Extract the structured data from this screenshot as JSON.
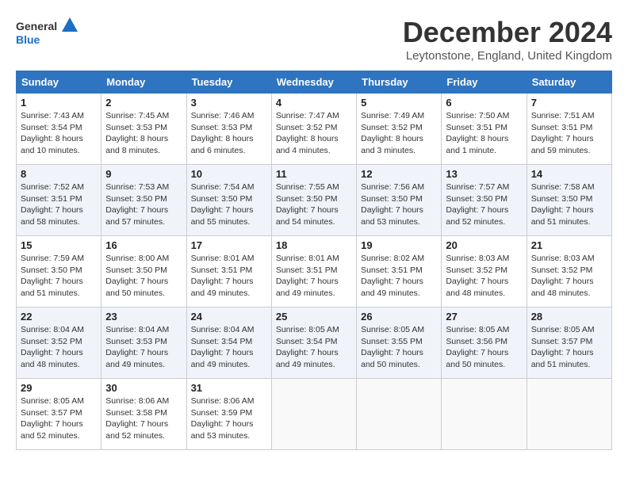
{
  "logo": {
    "line1": "General",
    "line2": "Blue"
  },
  "title": "December 2024",
  "location": "Leytonstone, England, United Kingdom",
  "weekdays": [
    "Sunday",
    "Monday",
    "Tuesday",
    "Wednesday",
    "Thursday",
    "Friday",
    "Saturday"
  ],
  "weeks": [
    [
      {
        "day": "1",
        "lines": [
          "Sunrise: 7:43 AM",
          "Sunset: 3:54 PM",
          "Daylight: 8 hours",
          "and 10 minutes."
        ]
      },
      {
        "day": "2",
        "lines": [
          "Sunrise: 7:45 AM",
          "Sunset: 3:53 PM",
          "Daylight: 8 hours",
          "and 8 minutes."
        ]
      },
      {
        "day": "3",
        "lines": [
          "Sunrise: 7:46 AM",
          "Sunset: 3:53 PM",
          "Daylight: 8 hours",
          "and 6 minutes."
        ]
      },
      {
        "day": "4",
        "lines": [
          "Sunrise: 7:47 AM",
          "Sunset: 3:52 PM",
          "Daylight: 8 hours",
          "and 4 minutes."
        ]
      },
      {
        "day": "5",
        "lines": [
          "Sunrise: 7:49 AM",
          "Sunset: 3:52 PM",
          "Daylight: 8 hours",
          "and 3 minutes."
        ]
      },
      {
        "day": "6",
        "lines": [
          "Sunrise: 7:50 AM",
          "Sunset: 3:51 PM",
          "Daylight: 8 hours",
          "and 1 minute."
        ]
      },
      {
        "day": "7",
        "lines": [
          "Sunrise: 7:51 AM",
          "Sunset: 3:51 PM",
          "Daylight: 7 hours",
          "and 59 minutes."
        ]
      }
    ],
    [
      {
        "day": "8",
        "lines": [
          "Sunrise: 7:52 AM",
          "Sunset: 3:51 PM",
          "Daylight: 7 hours",
          "and 58 minutes."
        ]
      },
      {
        "day": "9",
        "lines": [
          "Sunrise: 7:53 AM",
          "Sunset: 3:50 PM",
          "Daylight: 7 hours",
          "and 57 minutes."
        ]
      },
      {
        "day": "10",
        "lines": [
          "Sunrise: 7:54 AM",
          "Sunset: 3:50 PM",
          "Daylight: 7 hours",
          "and 55 minutes."
        ]
      },
      {
        "day": "11",
        "lines": [
          "Sunrise: 7:55 AM",
          "Sunset: 3:50 PM",
          "Daylight: 7 hours",
          "and 54 minutes."
        ]
      },
      {
        "day": "12",
        "lines": [
          "Sunrise: 7:56 AM",
          "Sunset: 3:50 PM",
          "Daylight: 7 hours",
          "and 53 minutes."
        ]
      },
      {
        "day": "13",
        "lines": [
          "Sunrise: 7:57 AM",
          "Sunset: 3:50 PM",
          "Daylight: 7 hours",
          "and 52 minutes."
        ]
      },
      {
        "day": "14",
        "lines": [
          "Sunrise: 7:58 AM",
          "Sunset: 3:50 PM",
          "Daylight: 7 hours",
          "and 51 minutes."
        ]
      }
    ],
    [
      {
        "day": "15",
        "lines": [
          "Sunrise: 7:59 AM",
          "Sunset: 3:50 PM",
          "Daylight: 7 hours",
          "and 51 minutes."
        ]
      },
      {
        "day": "16",
        "lines": [
          "Sunrise: 8:00 AM",
          "Sunset: 3:50 PM",
          "Daylight: 7 hours",
          "and 50 minutes."
        ]
      },
      {
        "day": "17",
        "lines": [
          "Sunrise: 8:01 AM",
          "Sunset: 3:51 PM",
          "Daylight: 7 hours",
          "and 49 minutes."
        ]
      },
      {
        "day": "18",
        "lines": [
          "Sunrise: 8:01 AM",
          "Sunset: 3:51 PM",
          "Daylight: 7 hours",
          "and 49 minutes."
        ]
      },
      {
        "day": "19",
        "lines": [
          "Sunrise: 8:02 AM",
          "Sunset: 3:51 PM",
          "Daylight: 7 hours",
          "and 49 minutes."
        ]
      },
      {
        "day": "20",
        "lines": [
          "Sunrise: 8:03 AM",
          "Sunset: 3:52 PM",
          "Daylight: 7 hours",
          "and 48 minutes."
        ]
      },
      {
        "day": "21",
        "lines": [
          "Sunrise: 8:03 AM",
          "Sunset: 3:52 PM",
          "Daylight: 7 hours",
          "and 48 minutes."
        ]
      }
    ],
    [
      {
        "day": "22",
        "lines": [
          "Sunrise: 8:04 AM",
          "Sunset: 3:52 PM",
          "Daylight: 7 hours",
          "and 48 minutes."
        ]
      },
      {
        "day": "23",
        "lines": [
          "Sunrise: 8:04 AM",
          "Sunset: 3:53 PM",
          "Daylight: 7 hours",
          "and 49 minutes."
        ]
      },
      {
        "day": "24",
        "lines": [
          "Sunrise: 8:04 AM",
          "Sunset: 3:54 PM",
          "Daylight: 7 hours",
          "and 49 minutes."
        ]
      },
      {
        "day": "25",
        "lines": [
          "Sunrise: 8:05 AM",
          "Sunset: 3:54 PM",
          "Daylight: 7 hours",
          "and 49 minutes."
        ]
      },
      {
        "day": "26",
        "lines": [
          "Sunrise: 8:05 AM",
          "Sunset: 3:55 PM",
          "Daylight: 7 hours",
          "and 50 minutes."
        ]
      },
      {
        "day": "27",
        "lines": [
          "Sunrise: 8:05 AM",
          "Sunset: 3:56 PM",
          "Daylight: 7 hours",
          "and 50 minutes."
        ]
      },
      {
        "day": "28",
        "lines": [
          "Sunrise: 8:05 AM",
          "Sunset: 3:57 PM",
          "Daylight: 7 hours",
          "and 51 minutes."
        ]
      }
    ],
    [
      {
        "day": "29",
        "lines": [
          "Sunrise: 8:05 AM",
          "Sunset: 3:57 PM",
          "Daylight: 7 hours",
          "and 52 minutes."
        ]
      },
      {
        "day": "30",
        "lines": [
          "Sunrise: 8:06 AM",
          "Sunset: 3:58 PM",
          "Daylight: 7 hours",
          "and 52 minutes."
        ]
      },
      {
        "day": "31",
        "lines": [
          "Sunrise: 8:06 AM",
          "Sunset: 3:59 PM",
          "Daylight: 7 hours",
          "and 53 minutes."
        ]
      },
      null,
      null,
      null,
      null
    ]
  ]
}
